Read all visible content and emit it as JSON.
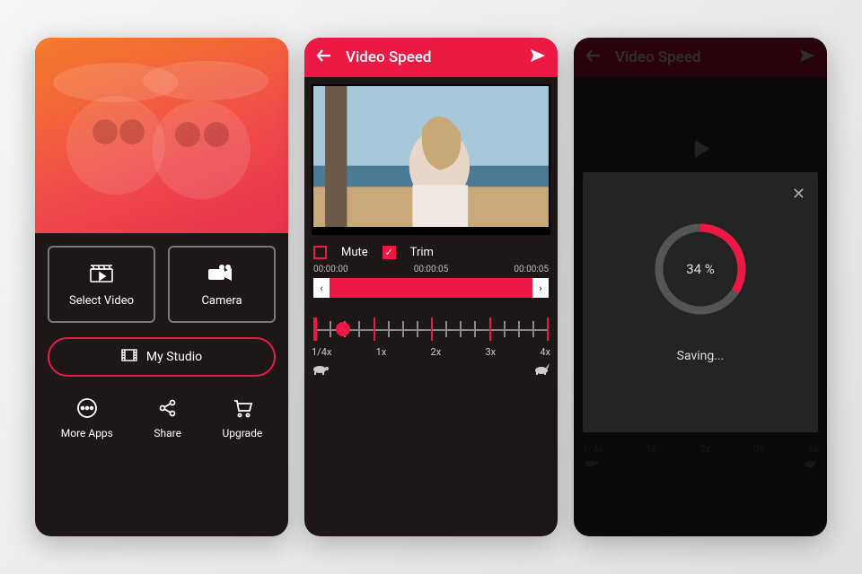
{
  "screen1": {
    "select_video": "Select Video",
    "camera": "Camera",
    "my_studio": "My Studio",
    "more_apps": "More Apps",
    "share": "Share",
    "upgrade": "Upgrade"
  },
  "screen2": {
    "title": "Video Speed",
    "mute_label": "Mute",
    "trim_label": "Trim",
    "mute_checked": false,
    "trim_checked": true,
    "time_start": "00:00:00",
    "time_mid": "00:00:05",
    "time_end": "00:00:05",
    "speed_labels": [
      "1/4x",
      "1x",
      "2x",
      "3x",
      "4x"
    ],
    "speed_selected_index": 0
  },
  "screen3": {
    "title": "Video Speed",
    "progress_percent": 34,
    "progress_label": "34 %",
    "status": "Saving...",
    "speed_labels": [
      "1/4x",
      "1x",
      "2x",
      "3x",
      "4x"
    ]
  },
  "colors": {
    "accent": "#ec1944",
    "bg": "#1d1717"
  }
}
